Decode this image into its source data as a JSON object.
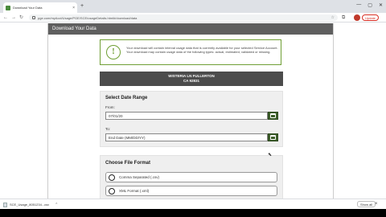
{
  "browser": {
    "tab_title": "Download Your Data",
    "tab_close": "×",
    "new_tab": "+",
    "win_controls": [
      "—",
      "▢",
      "✕"
    ],
    "url": "pge.com/myAcct/Usage/PGE/SCE/usageDetails.html#/download/data",
    "back": "←",
    "forward": "→",
    "reload": "↻",
    "update_button": "Update"
  },
  "modal": {
    "title": "Download Your Data",
    "notice_icon": "!",
    "notice_text": "Your download will contain interval usage data that is currently available for your selected Service Account. Your download may contain usage data of the following types: actual, estimated, validated or missing.",
    "address_line1": "WISTERIA LN FULLERTON",
    "address_line2": "CA 92831"
  },
  "date_range": {
    "title": "Select Date Range",
    "from_label": "From:",
    "from_value": "07/01/20",
    "to_label": "To:",
    "to_placeholder": "End Date (MM/DD/YY)"
  },
  "file_format": {
    "title": "Choose File Format",
    "options": [
      "Comma Separated (.csv)",
      "XML Format (.xml)"
    ]
  },
  "downloads": {
    "file_name": "SCE_Usage_8051234...csv",
    "more": "⌃",
    "show_all": "Show all",
    "close": "×"
  }
}
